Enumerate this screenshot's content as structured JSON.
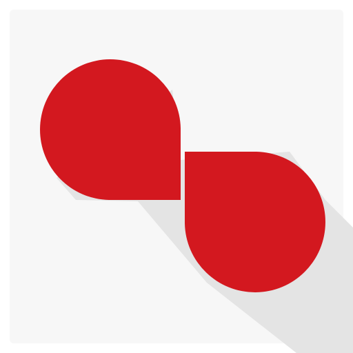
{
  "icon": {
    "name": "twin-droplet-logo",
    "colors": {
      "background": "#ffffff",
      "tile": "#f7f7f7",
      "long_shadow": "#e4e4e4",
      "droplet": "#d3181f"
    }
  }
}
